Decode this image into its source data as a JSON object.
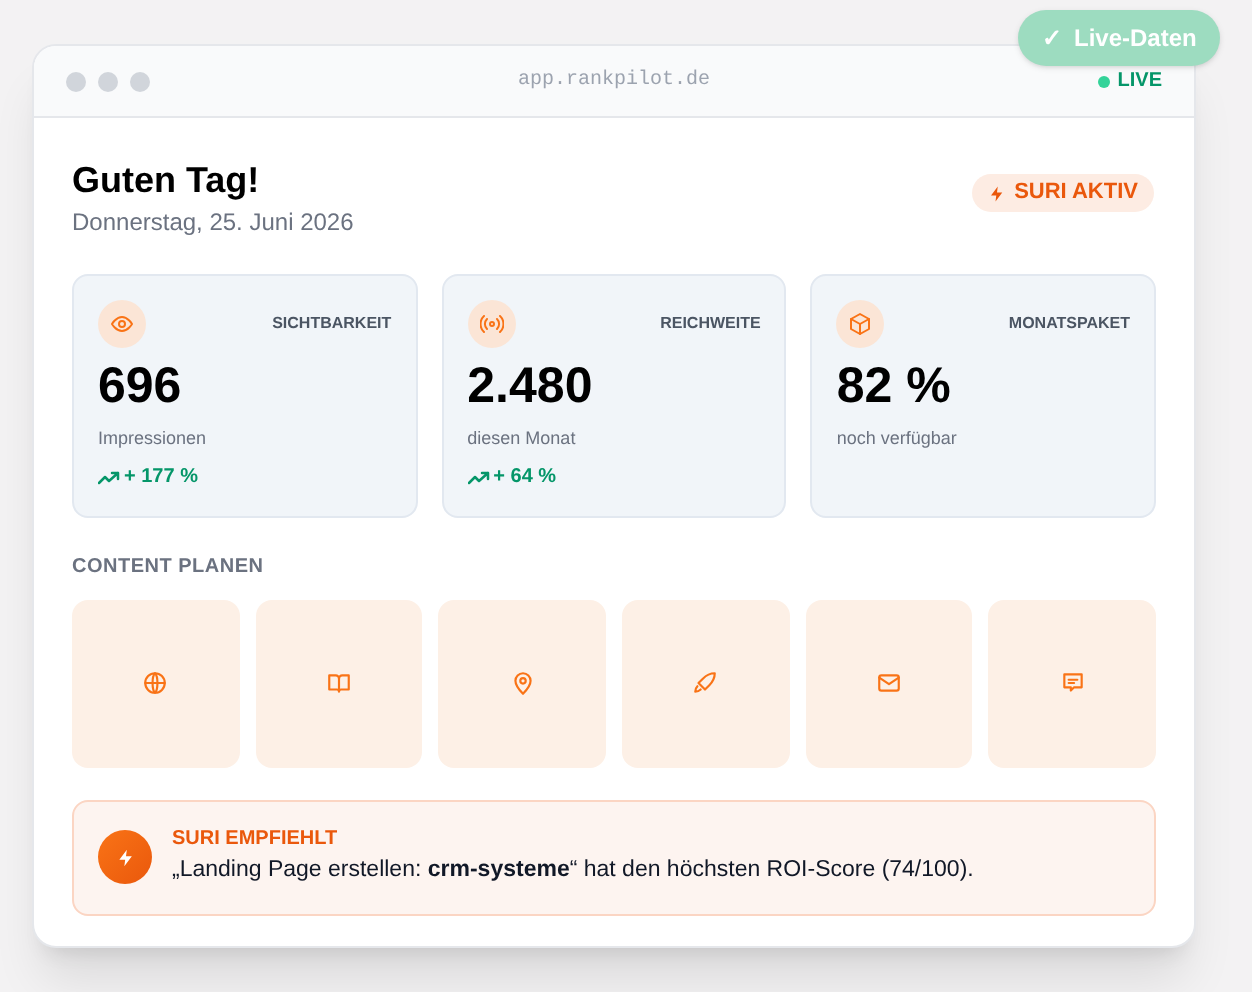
{
  "badge": {
    "label": "Live-Daten",
    "icon": "✓"
  },
  "window": {
    "url": "app.rankpilot.de",
    "status": "LIVE"
  },
  "header": {
    "greeting": "Guten Tag!",
    "date": "Donnerstag, 25. Juni 2026",
    "badge": "SURI AKTIV"
  },
  "stats": [
    {
      "kind": "eye",
      "label": "SICHTBARKEIT",
      "value": "696",
      "caption": "Impressionen",
      "trend": "+ 177 %"
    },
    {
      "kind": "signal",
      "label": "REICHWEITE",
      "value": "2.480",
      "caption": "diesen Monat",
      "trend": "+ 64 %"
    },
    {
      "kind": "box",
      "label": "MONATSPAKET",
      "value": "82 %",
      "caption": "noch verfügbar"
    }
  ],
  "content_section": {
    "title": "CONTENT PLANEN",
    "tiles": [
      {
        "kind": "globe"
      },
      {
        "kind": "book"
      },
      {
        "kind": "pin"
      },
      {
        "kind": "rocket"
      },
      {
        "kind": "mail"
      },
      {
        "kind": "chat"
      }
    ]
  },
  "recommendation": {
    "title": "SURI EMPFIEHLT",
    "text": "„Landing Page erstellen: **crm-systeme**“ hat den höchsten ROI-Score (74/100)."
  }
}
